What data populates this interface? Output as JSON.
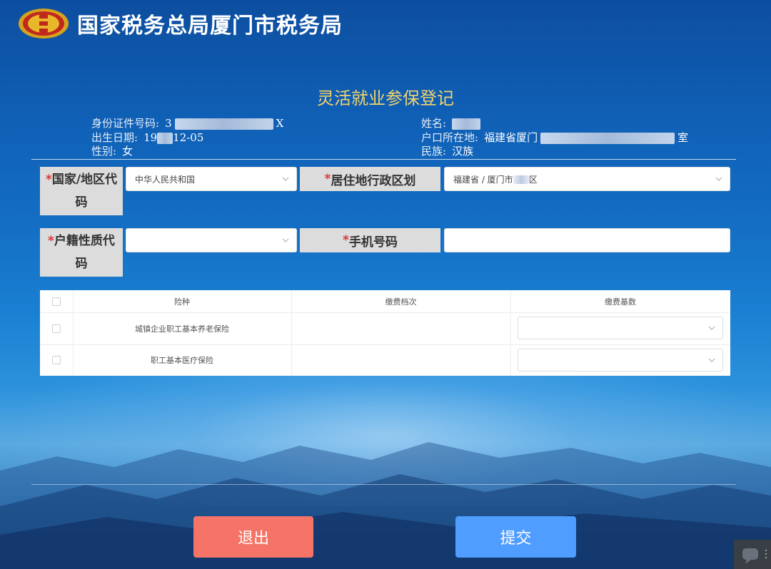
{
  "header": {
    "brand": "国家税务总局厦门市税务局"
  },
  "page": {
    "title": "灵活就业参保登记"
  },
  "person": {
    "id_label": "身份证件号码:",
    "id_prefix": "3",
    "id_suffix": "X",
    "birth_label": "出生日期:",
    "birth_prefix": "19",
    "birth_suffix": "12-05",
    "gender_label": "性别:",
    "gender_value": "女",
    "name_label": "姓名:",
    "address_label": "户口所在地:",
    "address_prefix": "福建省厦门",
    "address_suffix": "室",
    "ethnicity_label": "民族:",
    "ethnicity_value": "汉族"
  },
  "form": {
    "country": {
      "required_mark": "*",
      "label_line1": "国家/地区代",
      "label_line2": "码",
      "value": "中华人民共和国"
    },
    "residence": {
      "required_mark": "*",
      "label": "居住地行政区划",
      "value_prefix": "福建省 / 厦门市",
      "value_suffix": "区"
    },
    "household": {
      "required_mark": "*",
      "label_line1": "户籍性质代",
      "label_line2": "码",
      "value": ""
    },
    "phone": {
      "required_mark": "*",
      "label": "手机号码",
      "value": ""
    }
  },
  "table": {
    "columns": [
      "险种",
      "缴费档次",
      "缴费基数"
    ],
    "rows": [
      {
        "insurance": "城镇企业职工基本养老保险",
        "level": "",
        "base": ""
      },
      {
        "insurance": "职工基本医疗保险",
        "level": "",
        "base": ""
      }
    ]
  },
  "buttons": {
    "exit": "退出",
    "submit": "提交"
  },
  "colors": {
    "title": "#f2d36b",
    "required": "#e02020",
    "exit_button": "#f57467",
    "submit_button": "#4f9dff"
  }
}
